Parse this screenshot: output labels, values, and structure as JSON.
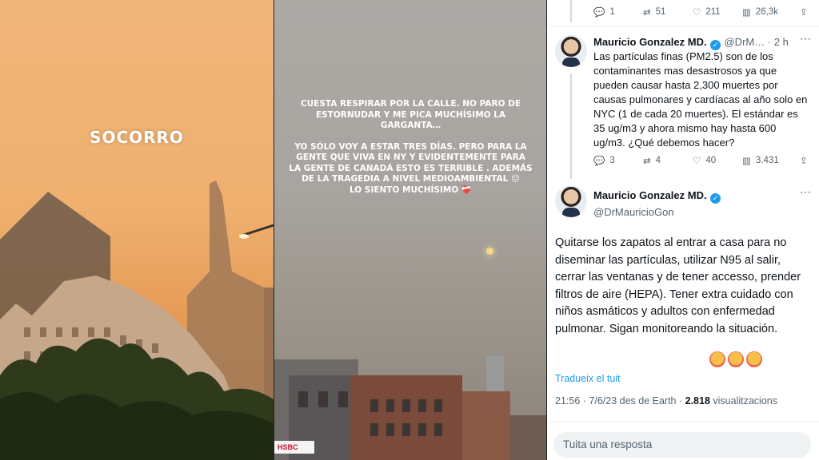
{
  "left_story": {
    "overlay_text": "SOCORRO"
  },
  "middle_story": {
    "paragraph1": "CUESTA RESPIRAR POR LA CALLE. NO PARO DE ESTORNUDAR Y ME PICA MUCHÍSIMO LA GARGANTA…",
    "paragraph2": "YO SÓLO VOY A ESTAR TRES DÍAS. PERO PARA LA GENTE QUE VIVA EN NY Y EVIDENTEMENTE PARA LA GENTE DE CANADÁ ESTO ES TERRIBLE . ADEMÁS DE LA TRAGEDIA A NIVEL MEDIOAMBIENTAL 😔",
    "paragraph3": "LO SIENTO MUCHÍSIMO ❤️‍🩹",
    "storefront_sign": "HSBC"
  },
  "tweet_thread": {
    "prev_actions": {
      "replies": "1",
      "retweets": "51",
      "likes": "211",
      "views": "26,3k"
    },
    "reply_tweet": {
      "author_name": "Mauricio Gonzalez MD.",
      "handle_time": "@DrM… · 2 h",
      "text": "Las partículas finas (PM2.5) son de los contaminantes mas desastrosos ya que pueden causar hasta 2,300 muertes por causas pulmonares y cardíacas al año solo en NYC (1 de cada 20 muertes). El estándar es 35 ug/m3 y ahora mismo hay hasta 600 ug/m3. ¿Qué debemos hacer?",
      "actions": {
        "replies": "3",
        "retweets": "4",
        "likes": "40",
        "views": "3.431"
      }
    },
    "main_tweet": {
      "author_name": "Mauricio Gonzalez MD.",
      "handle": "@DrMauricioGon",
      "text": "Quitarse los zapatos al entrar a casa para no diseminar las partículas, utilizar N95 al salir, cerrar las ventanas y de tener accesso, prender filtros de aire (HEPA). Tener extra cuidado con niños asmáticos y adultos con enfermedad pulmonar. Sigan monitoreando la situación.",
      "translate_label": "Tradueix el tuit",
      "time_date": "21:56 · 7/6/23 des de Earth ·",
      "views_count": "2.818",
      "views_label": "visualitzacions"
    },
    "reply_placeholder": "Tuita una resposta",
    "colors": {
      "accent": "#1d9bf0",
      "text": "#0f1419",
      "muted": "#536471"
    }
  }
}
